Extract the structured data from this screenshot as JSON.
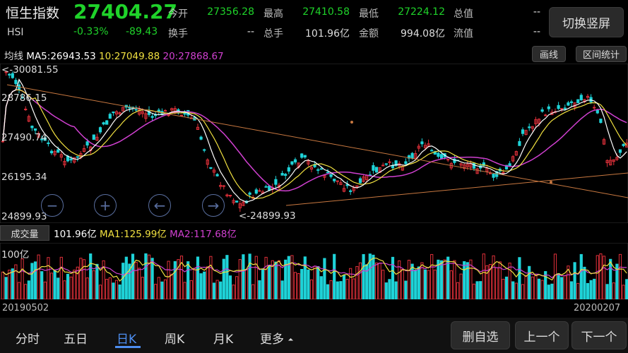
{
  "header": {
    "name": "恒生指数",
    "code": "HSI",
    "price": "27404.27",
    "change_pct": "-0.33%",
    "change_abs": "-89.43",
    "stats": [
      {
        "label": "今开",
        "value": "27356.28"
      },
      {
        "label": "最高",
        "value": "27410.58"
      },
      {
        "label": "最低",
        "value": "27224.12"
      },
      {
        "label": "总值",
        "value": "--"
      },
      {
        "label": "换手",
        "value": "--"
      },
      {
        "label": "总手",
        "value": "101.96亿"
      },
      {
        "label": "金额",
        "value": "994.08亿"
      },
      {
        "label": "流值",
        "value": "--"
      }
    ],
    "switch_button": "切换竖屏"
  },
  "toolbar": {
    "draw_button": "画线",
    "range_button": "区间统计"
  },
  "ma": {
    "label": "均线",
    "ma5": "MA5:26943.53",
    "ma10": "10:27049.88",
    "ma20": "20:27868.67"
  },
  "price_axis": [
    "28786.15",
    "27490.74",
    "26195.34",
    "24899.93"
  ],
  "annotations": {
    "high": "<-30081.55",
    "low": "<-24899.93"
  },
  "volume": {
    "tab_label": "成交量",
    "value": "101.96亿",
    "ma1": "MA1:125.99亿",
    "ma2": "MA2:117.68亿",
    "axis_label": "100亿"
  },
  "dates": {
    "start": "20190502",
    "end": "20200207"
  },
  "bottom_tabs": [
    {
      "label": "分时"
    },
    {
      "label": "五日"
    },
    {
      "label": "日K"
    },
    {
      "label": "周K"
    },
    {
      "label": "月K"
    },
    {
      "label": "更多"
    }
  ],
  "bottom_buttons": {
    "delete": "删自选",
    "prev": "上一个",
    "next": "下一个"
  },
  "colors": {
    "up": "#e0303a",
    "down": "#1fd3d8",
    "ma5": "#ffffff",
    "ma10": "#f0e040",
    "ma20": "#d040d0",
    "price_green": "#1fd32a",
    "active_tab": "#4d8ef0"
  }
}
